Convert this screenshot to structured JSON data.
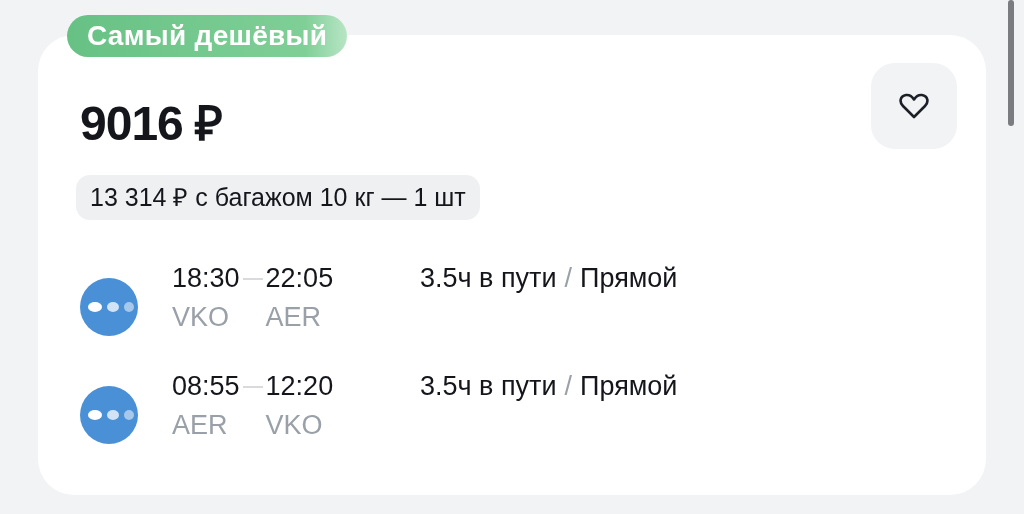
{
  "badge": "Самый дешёвый",
  "price": "9016 ₽",
  "baggage_price": "13 314 ₽ с багажом 10 кг — 1 шт",
  "segments": [
    {
      "departure_time": "18:30",
      "arrival_time": "22:05",
      "from": "VKO",
      "to": "AER",
      "duration": "3.5ч в пути",
      "separator": "/",
      "stops": "Прямой"
    },
    {
      "departure_time": "08:55",
      "arrival_time": "12:20",
      "from": "AER",
      "to": "VKO",
      "duration": "3.5ч в пути",
      "separator": "/",
      "stops": "Прямой"
    }
  ]
}
